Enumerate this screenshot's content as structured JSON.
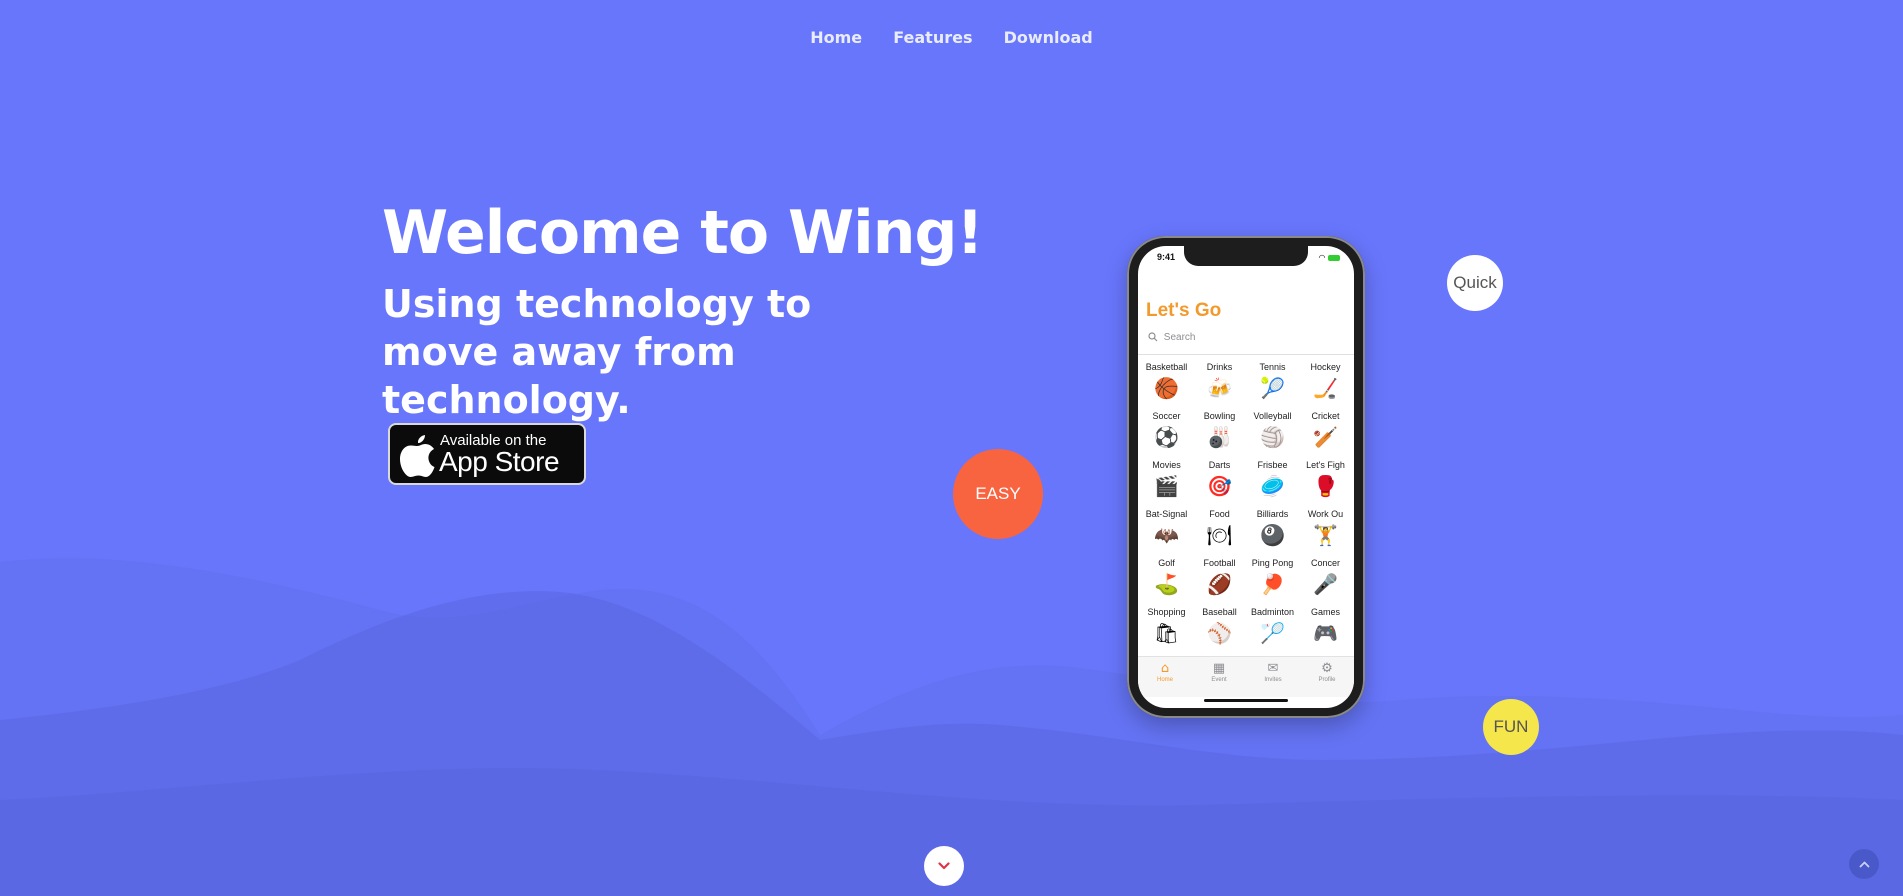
{
  "nav": {
    "items": [
      "Home",
      "Features",
      "Download"
    ]
  },
  "hero": {
    "title": "Welcome to Wing!",
    "subtitle": "Using technology to move away from technology."
  },
  "appstore_badge": {
    "line1": "Available on the",
    "line2": "App Store"
  },
  "bubbles": {
    "easy": "EASY",
    "quick": "Quick",
    "fun": "FUN"
  },
  "phone": {
    "time": "9:41",
    "app_title": "Let's Go",
    "search_placeholder": "Search",
    "grid": [
      {
        "label": "Basketball",
        "icon": "🏀"
      },
      {
        "label": "Drinks",
        "icon": "🍻"
      },
      {
        "label": "Tennis",
        "icon": "🎾"
      },
      {
        "label": "Hockey",
        "icon": "🏒"
      },
      {
        "label": "Soccer",
        "icon": "⚽"
      },
      {
        "label": "Bowling",
        "icon": "🎳"
      },
      {
        "label": "Volleyball",
        "icon": "🏐"
      },
      {
        "label": "Cricket",
        "icon": "🏏"
      },
      {
        "label": "Movies",
        "icon": "🎬"
      },
      {
        "label": "Darts",
        "icon": "🎯"
      },
      {
        "label": "Frisbee",
        "icon": "🥏"
      },
      {
        "label": "Let's Figh",
        "icon": "🥊"
      },
      {
        "label": "Bat-Signal",
        "icon": "🦇"
      },
      {
        "label": "Food",
        "icon": "🍽"
      },
      {
        "label": "Billiards",
        "icon": "🎱"
      },
      {
        "label": "Work Ou",
        "icon": "🏋"
      },
      {
        "label": "Golf",
        "icon": "⛳"
      },
      {
        "label": "Football",
        "icon": "🏈"
      },
      {
        "label": "Ping Pong",
        "icon": "🏓"
      },
      {
        "label": "Concer",
        "icon": "🎤"
      },
      {
        "label": "Shopping",
        "icon": "🛍"
      },
      {
        "label": "Baseball",
        "icon": "⚾"
      },
      {
        "label": "Badminton",
        "icon": "🏸"
      },
      {
        "label": "Games",
        "icon": "🎮"
      }
    ],
    "tabs": [
      {
        "label": "Home",
        "icon": "⌂"
      },
      {
        "label": "Event",
        "icon": "▦"
      },
      {
        "label": "Invites",
        "icon": "✉"
      },
      {
        "label": "Profile",
        "icon": "⚙"
      }
    ]
  },
  "colors": {
    "background": "#6876fc",
    "accent_orange": "#f39a2c",
    "easy_bubble": "#f86440",
    "fun_bubble": "#f5e64b"
  },
  "icons": {
    "scroll_down": "chevron-down-icon",
    "back_to_top": "chevron-up-icon",
    "apple_logo": "apple-icon"
  }
}
